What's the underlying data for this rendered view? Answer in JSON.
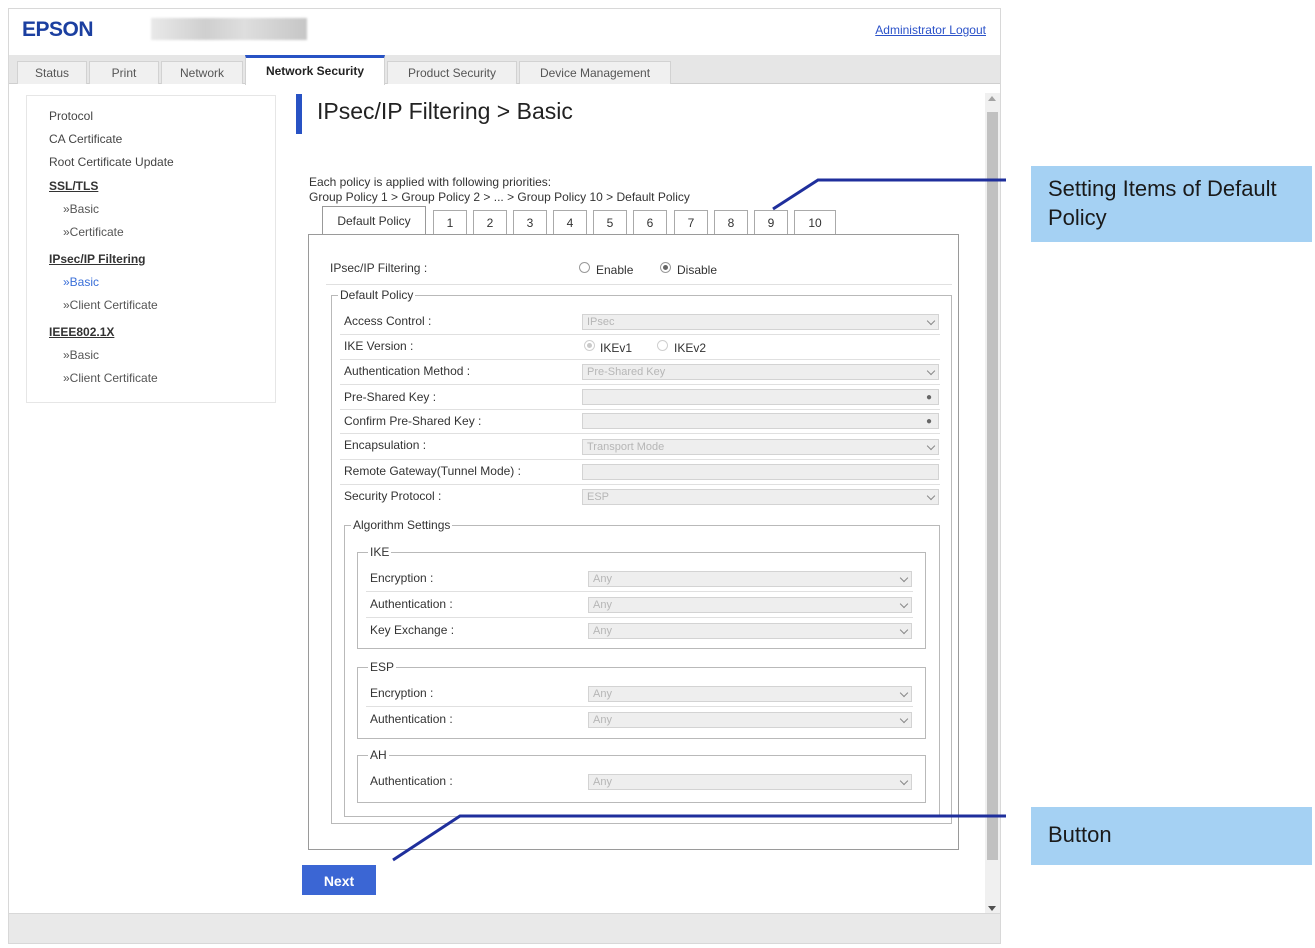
{
  "header": {
    "logo": "EPSON",
    "logout": "Administrator Logout"
  },
  "tabs": [
    {
      "label": "Status"
    },
    {
      "label": "Print"
    },
    {
      "label": "Network"
    },
    {
      "label": "Network Security",
      "active": true
    },
    {
      "label": "Product Security"
    },
    {
      "label": "Device Management"
    }
  ],
  "sidebar": {
    "items": [
      {
        "label": "Protocol"
      },
      {
        "label": "CA Certificate"
      },
      {
        "label": "Root Certificate Update"
      },
      {
        "label": "SSL/TLS"
      },
      {
        "label": "»Basic"
      },
      {
        "label": "»Certificate"
      },
      {
        "label": "IPsec/IP Filtering"
      },
      {
        "label": "»Basic"
      },
      {
        "label": "»Client Certificate"
      },
      {
        "label": "IEEE802.1X"
      },
      {
        "label": "»Basic"
      },
      {
        "label": "»Client Certificate"
      }
    ]
  },
  "page": {
    "title": "IPsec/IP Filtering > Basic",
    "desc_line1": "Each policy is applied with following priorities:",
    "desc_line2": "Group Policy 1 > Group Policy 2 > ... > Group Policy 10 > Default Policy"
  },
  "policy_tabs": [
    "Default Policy",
    "1",
    "2",
    "3",
    "4",
    "5",
    "6",
    "7",
    "8",
    "9",
    "10"
  ],
  "form": {
    "ipsec_filtering_label": "IPsec/IP Filtering :",
    "enable_label": "Enable",
    "disable_label": "Disable",
    "default_policy_legend": "Default Policy",
    "access_control_label": "Access Control :",
    "access_control_value": "IPsec",
    "ike_version_label": "IKE Version :",
    "ikev1_label": "IKEv1",
    "ikev2_label": "IKEv2",
    "auth_method_label": "Authentication Method :",
    "auth_method_value": "Pre-Shared Key",
    "psk_label": "Pre-Shared Key :",
    "confirm_psk_label": "Confirm Pre-Shared Key :",
    "encapsulation_label": "Encapsulation :",
    "encapsulation_value": "Transport Mode",
    "remote_gateway_label": "Remote Gateway(Tunnel Mode) :",
    "security_protocol_label": "Security Protocol :",
    "security_protocol_value": "ESP",
    "algorithm_legend": "Algorithm Settings",
    "ike_legend": "IKE",
    "ike_encryption_label": "Encryption :",
    "ike_authentication_label": "Authentication :",
    "key_exchange_label": "Key Exchange :",
    "esp_legend": "ESP",
    "esp_encryption_label": "Encryption :",
    "esp_authentication_label": "Authentication :",
    "ah_legend": "AH",
    "ah_authentication_label": "Authentication :",
    "any_value": "Any"
  },
  "next_button": "Next",
  "callouts": {
    "setting_items": "Setting Items of Default Policy",
    "button": "Button"
  },
  "colors": {
    "accent": "#2852c4",
    "callout_bg": "#a5d1f3",
    "callout_line": "#1f2f9c"
  }
}
